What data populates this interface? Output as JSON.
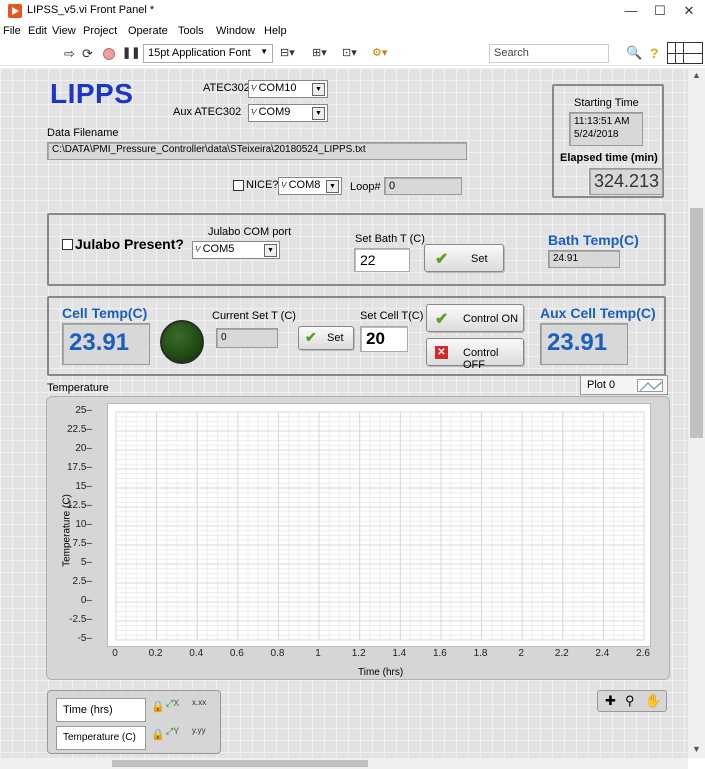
{
  "window": {
    "title": "LIPSS_v5.vi Front Panel *",
    "minimize": "—",
    "maximize": "☐",
    "close": "✕"
  },
  "menu": [
    "File",
    "Edit",
    "View",
    "Project",
    "Operate",
    "Tools",
    "Window",
    "Help"
  ],
  "toolbar": {
    "font": "15pt Application Font",
    "search_placeholder": "Search"
  },
  "app": {
    "title": "LIPPS"
  },
  "ports": {
    "atec302_label": "ATEC302",
    "atec302_value": "COM10",
    "aux_label": "Aux ATEC302",
    "aux_value": "COM9"
  },
  "file": {
    "label": "Data Filename",
    "path": "C:\\DATA\\PMI_Pressure_Controller\\data\\STeixeira\\20180524_LIPPS.txt"
  },
  "nice": {
    "label": "NICE?",
    "port": "COM8",
    "loop_label": "Loop#",
    "loop_value": "0"
  },
  "time": {
    "start_label": "Starting Time",
    "start_time": "11:13:51 AM",
    "start_date": "5/24/2018",
    "elapsed_label": "Elapsed time (min)",
    "elapsed_value": "324.213"
  },
  "julabo": {
    "present_label": "Julabo Present?",
    "com_label": "Julabo COM port",
    "com_value": "COM5",
    "setbath_label": "Set Bath T (C)",
    "setbath_value": "22",
    "set_button": "Set",
    "bath_label": "Bath Temp(C)",
    "bath_value": "24.91"
  },
  "cell": {
    "cell_label": "Cell Temp(C)",
    "cell_value": "23.91",
    "current_label": "Current Set T (C)",
    "current_value": "0",
    "set_button": "Set",
    "setcell_label": "Set Cell T(C)",
    "setcell_value": "20",
    "on_button": "Control ON",
    "off_button": "Control OFF",
    "aux_label": "Aux Cell Temp(C)",
    "aux_value": "23.91"
  },
  "graph": {
    "title": "Temperature",
    "plot_legend": "Plot 0",
    "xlabel": "Time (hrs)",
    "ylabel": "Temperature (C)"
  },
  "scales": {
    "x_name": "Time (hrs)",
    "y_name": "Temperature (C)"
  },
  "colors": {
    "panel": "#e2e2e2",
    "accent_blue": "#1b5fbd",
    "led": "#1f4a12"
  },
  "chart_data": {
    "type": "line",
    "title": "Temperature",
    "xlabel": "Time (hrs)",
    "ylabel": "Temperature (C)",
    "xlim": [
      0,
      2.6
    ],
    "ylim": [
      -5,
      25
    ],
    "x_ticks": [
      "0",
      "0.2",
      "0.4",
      "0.6",
      "0.8",
      "1",
      "1.2",
      "1.4",
      "1.6",
      "1.8",
      "2",
      "2.2",
      "2.4",
      "2.6"
    ],
    "y_ticks": [
      "25",
      "22.5",
      "20",
      "17.5",
      "15",
      "12.5",
      "10",
      "7.5",
      "5",
      "2.5",
      "0",
      "-2.5",
      "-5"
    ],
    "grid": true,
    "series": []
  }
}
